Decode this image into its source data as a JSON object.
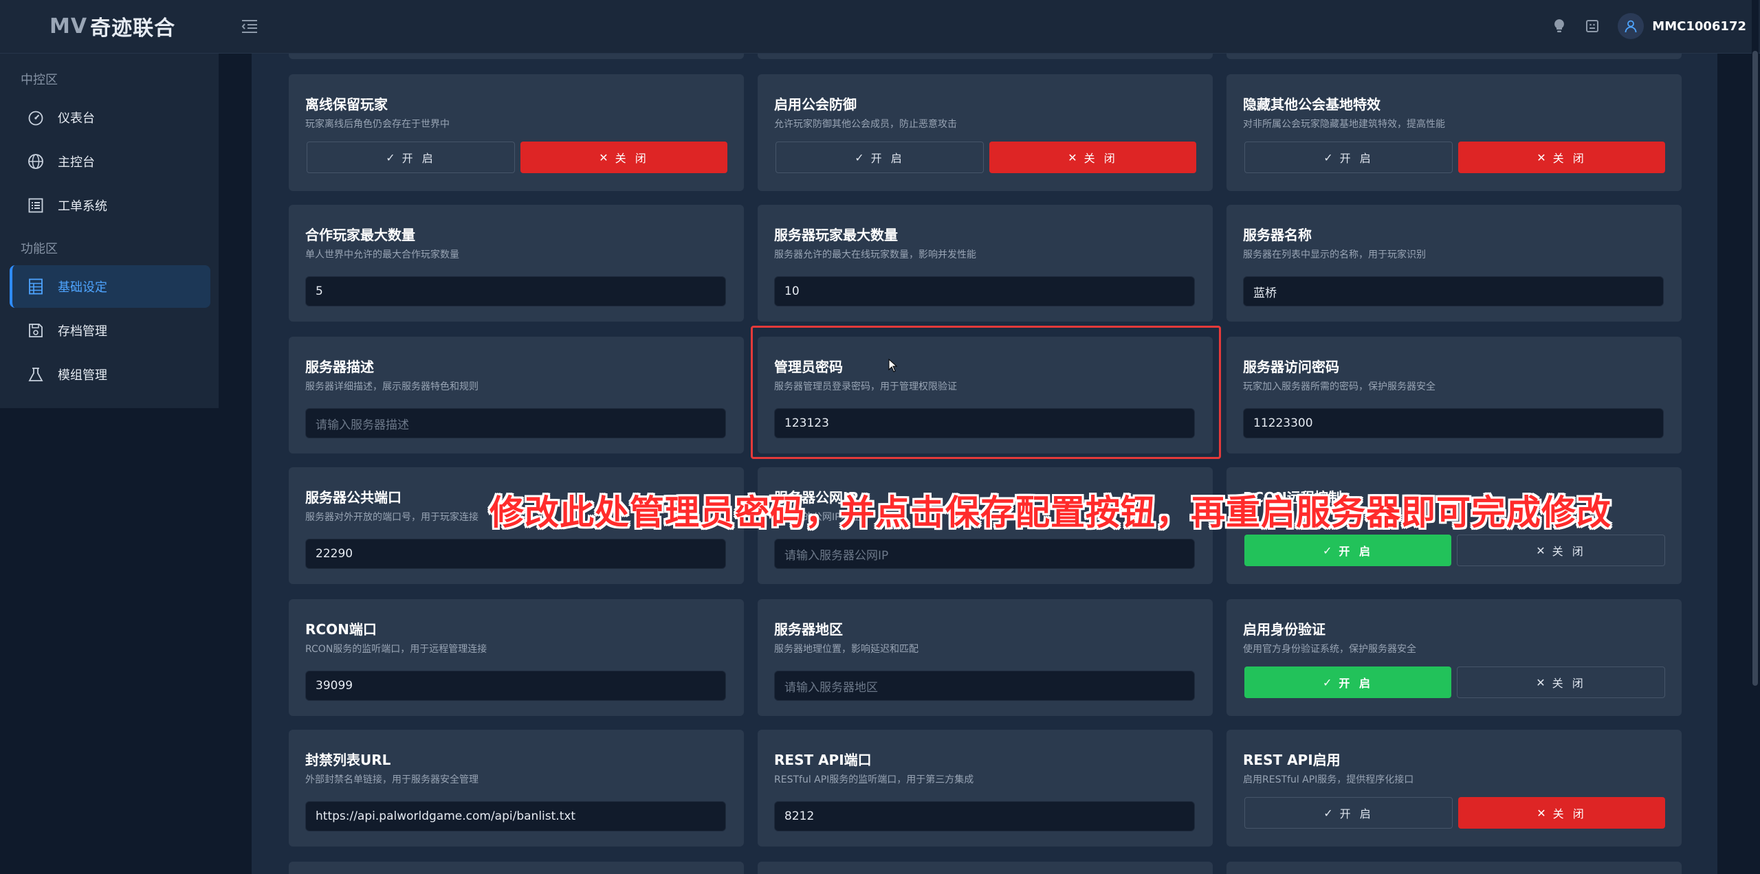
{
  "header": {
    "brand_mark": "MV",
    "brand_name": "奇迹联合",
    "username": "MMC1006172"
  },
  "sidebar": {
    "group1": "中控区",
    "group2": "功能区",
    "items": [
      {
        "label": "仪表台",
        "icon": "gauge-icon"
      },
      {
        "label": "主控台",
        "icon": "globe-icon"
      },
      {
        "label": "工单系统",
        "icon": "list-icon"
      },
      {
        "label": "基础设定",
        "icon": "table-icon",
        "active": true
      },
      {
        "label": "存档管理",
        "icon": "save-icon"
      },
      {
        "label": "模组管理",
        "icon": "flask-icon"
      }
    ]
  },
  "toggle": {
    "on": "开 启",
    "off": "关 闭"
  },
  "cards": {
    "offline": {
      "title": "离线保留玩家",
      "desc": "玩家离线后角色仍会存在于世界中",
      "state": "off"
    },
    "guild_defense": {
      "title": "启用公会防御",
      "desc": "允许玩家防御其他公会成员，防止恶意攻击",
      "state": "off"
    },
    "hide_guild": {
      "title": "隐藏其他公会基地特效",
      "desc": "对非所属公会玩家隐藏基地建筑特效，提高性能",
      "state": "off"
    },
    "coop_max": {
      "title": "合作玩家最大数量",
      "desc": "单人世界中允许的最大合作玩家数量",
      "value": "5"
    },
    "server_max": {
      "title": "服务器玩家最大数量",
      "desc": "服务器允许的最大在线玩家数量，影响并发性能",
      "value": "10"
    },
    "server_name": {
      "title": "服务器名称",
      "desc": "服务器在列表中显示的名称，用于玩家识别",
      "value": "蓝桥"
    },
    "server_desc": {
      "title": "服务器描述",
      "desc": "服务器详细描述，展示服务器特色和规则",
      "placeholder": "请输入服务器描述"
    },
    "admin_pwd": {
      "title": "管理员密码",
      "desc": "服务器管理员登录密码，用于管理权限验证",
      "value": "123123"
    },
    "access_pwd": {
      "title": "服务器访问密码",
      "desc": "玩家加入服务器所需的密码，保护服务器安全",
      "value": "11223300"
    },
    "public_port": {
      "title": "服务器公共端口",
      "desc": "服务器对外开放的端口号，用于玩家连接",
      "value": "22290"
    },
    "public_ip": {
      "title": "服务器公网IP",
      "desc": "服务器的公网IP地址",
      "placeholder": "请输入服务器公网IP"
    },
    "rcon_enable": {
      "title": "RCON远程控制",
      "desc": "",
      "state": "on"
    },
    "rcon_port": {
      "title": "RCON端口",
      "desc": "RCON服务的监听端口，用于远程管理连接",
      "value": "39099"
    },
    "region": {
      "title": "服务器地区",
      "desc": "服务器地理位置，影响延迟和匹配",
      "placeholder": "请输入服务器地区"
    },
    "auth": {
      "title": "启用身份验证",
      "desc": "使用官方身份验证系统，保护服务器安全",
      "state": "on"
    },
    "banlist": {
      "title": "封禁列表URL",
      "desc": "外部封禁名单链接，用于服务器安全管理",
      "value": "https://api.palworldgame.com/api/banlist.txt"
    },
    "rest_port": {
      "title": "REST API端口",
      "desc": "RESTful API服务的监听端口，用于第三方集成",
      "value": "8212"
    },
    "rest_enable": {
      "title": "REST API启用",
      "desc": "启用RESTful API服务，提供程序化接口",
      "state": "off"
    }
  },
  "annotation": "修改此处管理员密码，并点击保存配置按钮，再重启服务器即可完成修改",
  "colors": {
    "accent": "#2f8cff",
    "danger": "#de2525",
    "success": "#22c25a",
    "highlight": "#e43a3a"
  }
}
